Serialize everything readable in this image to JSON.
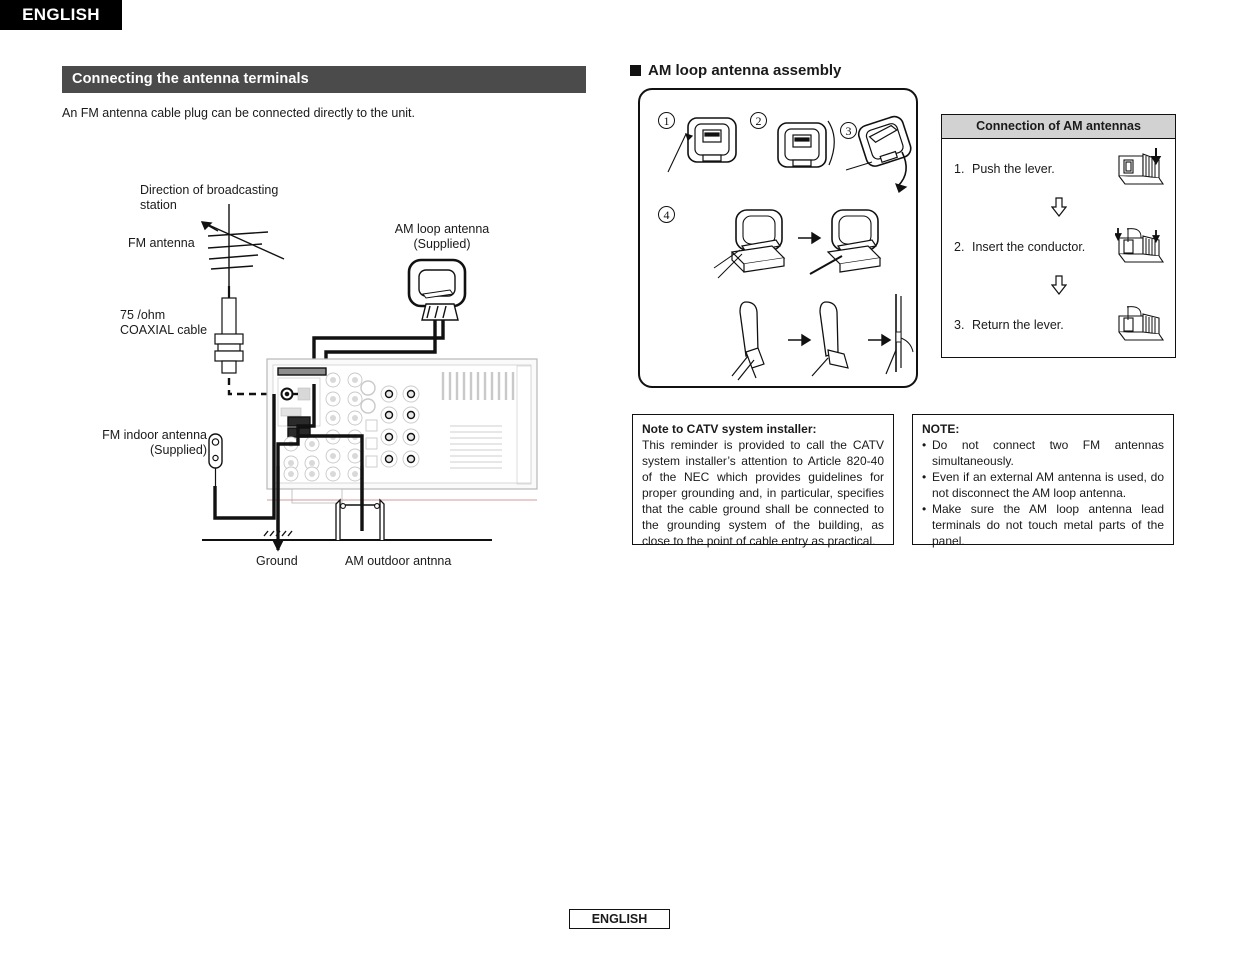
{
  "page": {
    "language_tab": "ENGLISH",
    "footer_label": "ENGLISH"
  },
  "left": {
    "section_title": "Connecting the antenna terminals",
    "intro": "An FM antenna cable plug can be connected directly to the unit.",
    "diagram_labels": {
      "direction": "Direction of broadcasting\nstation",
      "fm_antenna": "FM antenna",
      "am_loop_antenna": "AM loop antenna\n(Supplied)",
      "coaxial": "75   /ohm\nCOAXIAL cable",
      "fm_indoor": "FM indoor antenna\n(Supplied)",
      "ground": "Ground",
      "am_outdoor": "AM outdoor antnna"
    }
  },
  "right": {
    "assembly_heading": "AM loop antenna assembly",
    "step_numbers": [
      "1",
      "2",
      "3",
      "4"
    ],
    "am_table": {
      "header": "Connection of AM antennas",
      "rows": [
        {
          "num": "1.",
          "text": "Push the lever."
        },
        {
          "num": "2.",
          "text": "Insert the conductor."
        },
        {
          "num": "3.",
          "text": "Return the lever."
        }
      ],
      "arrow_glyph": "⇓"
    },
    "catv_note": {
      "title": "Note to CATV system installer:",
      "body": "This reminder is provided to call the CATV system installer’s attention to Article 820-40 of the NEC which provides guidelines for proper grounding and, in particular, specifies that the cable ground shall be connected to the grounding system of the building, as close to the point of cable entry as practical."
    },
    "note": {
      "title": "NOTE:",
      "bullet_glyph": "•",
      "items": [
        "Do not connect two FM antennas simultaneously.",
        "Even if an external AM antenna is used, do not disconnect the AM loop antenna.",
        "Make sure the AM loop antenna lead terminals do not touch metal parts of the panel."
      ]
    }
  },
  "colors": {
    "section_bar": "#4b4b4b",
    "table_header": "#d2d2d2",
    "tab_bg": "#000000",
    "text": "#1a1a1a"
  }
}
